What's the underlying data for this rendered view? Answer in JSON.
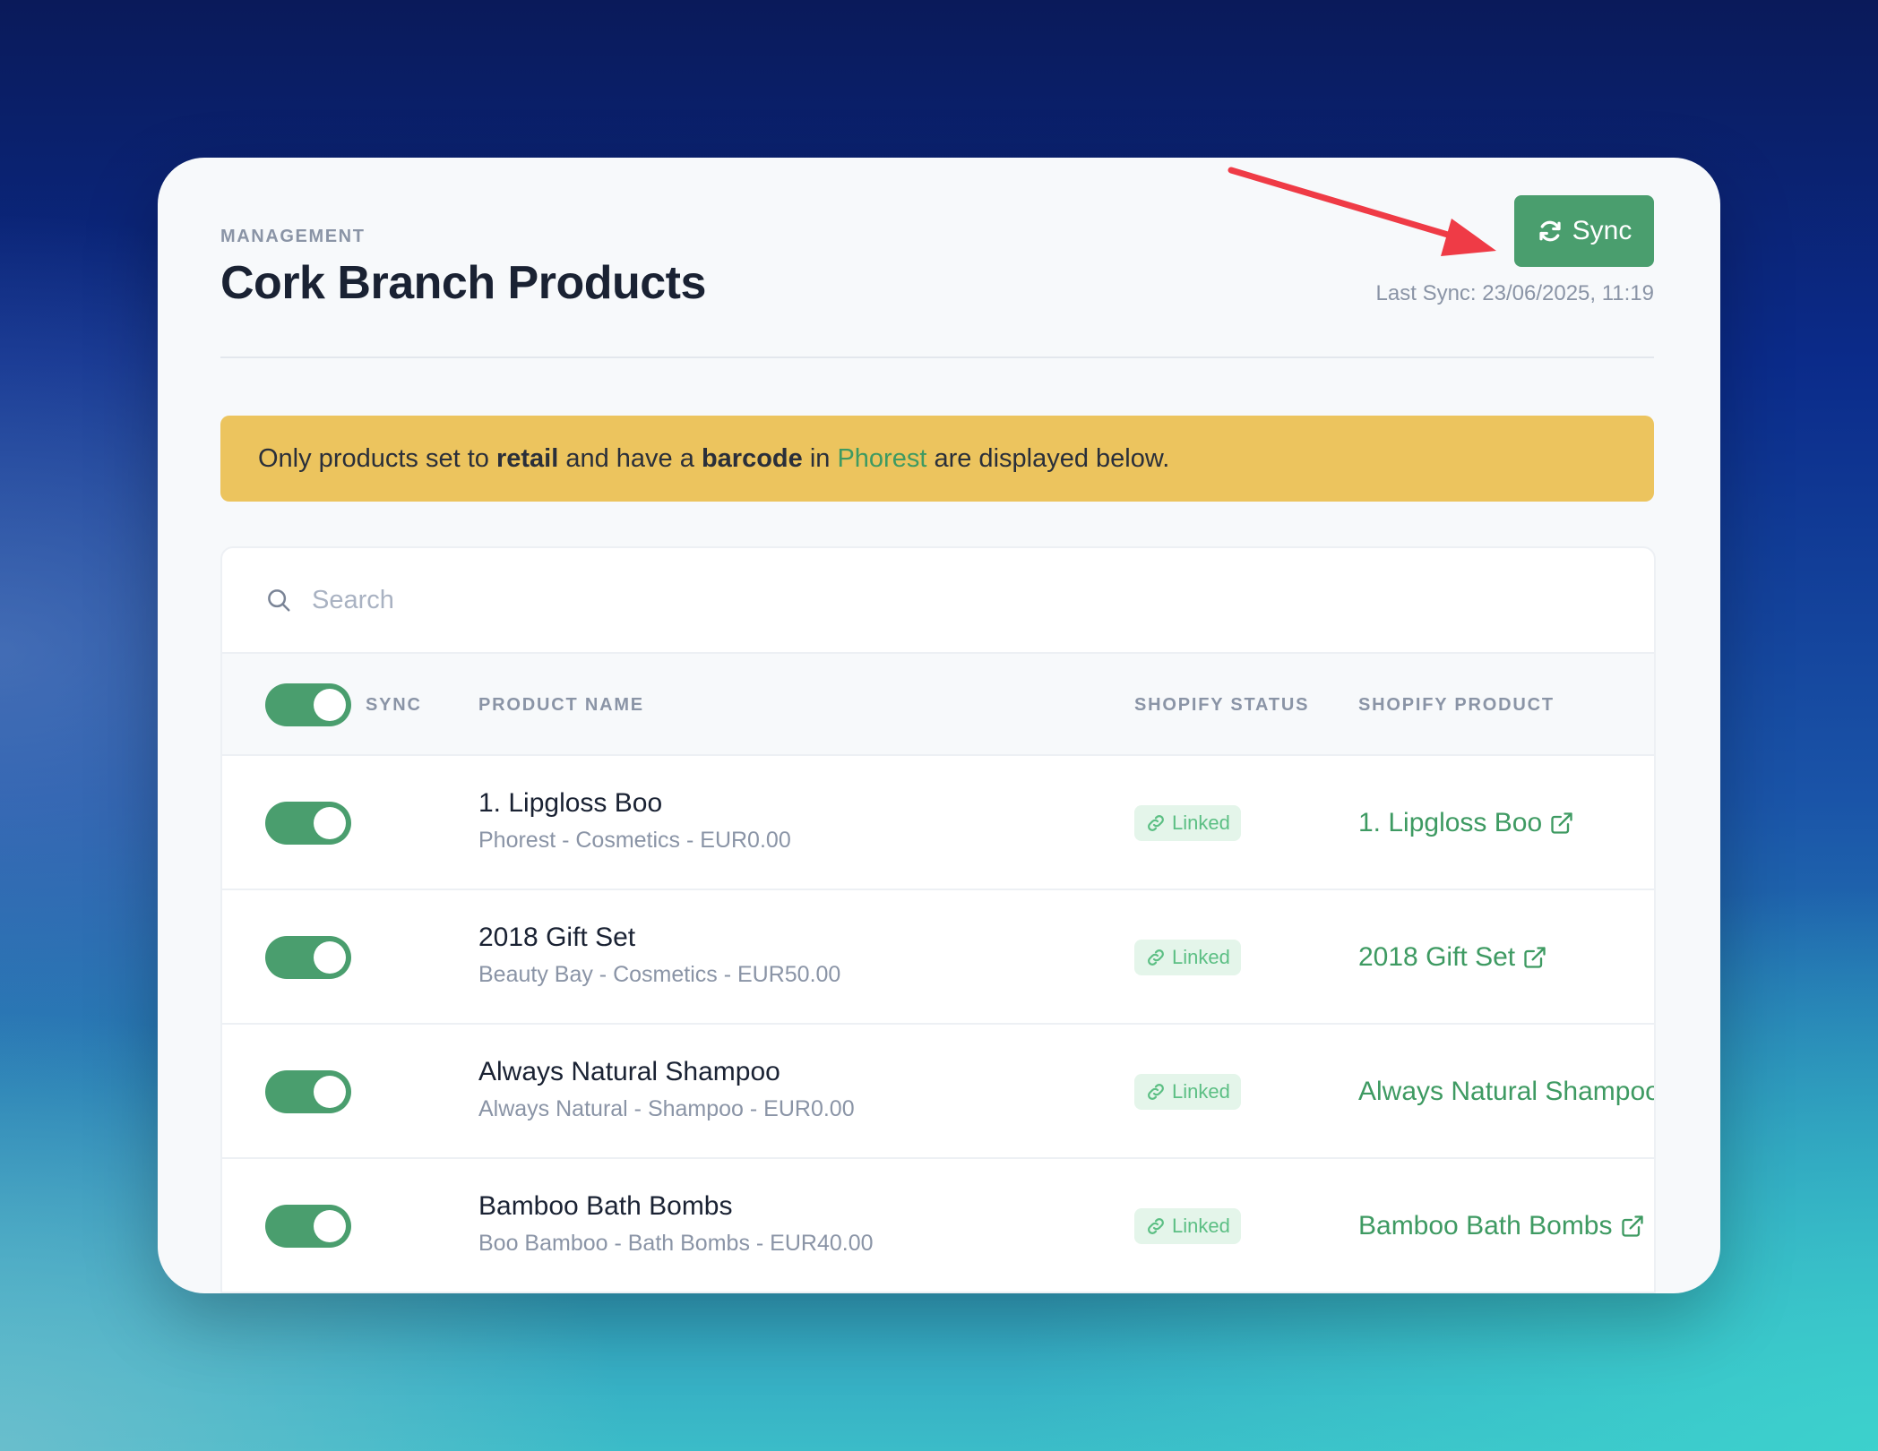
{
  "header": {
    "eyebrow": "MANAGEMENT",
    "title": "Cork Branch Products",
    "sync_button": "Sync",
    "last_sync": "Last Sync: 23/06/2025, 11:19"
  },
  "notice": {
    "part1": "Only products set to ",
    "bold1": "retail",
    "part2": " and have a ",
    "bold2": "barcode",
    "part3": " in ",
    "brand": "Phorest",
    "part4": " are displayed below."
  },
  "search": {
    "placeholder": "Search",
    "value": ""
  },
  "table": {
    "columns": {
      "sync": "SYNC",
      "product_name": "PRODUCT NAME",
      "shopify_status": "SHOPIFY STATUS",
      "shopify_product": "SHOPIFY PRODUCT"
    },
    "sync_all": true,
    "rows": [
      {
        "name": "1. Lipgloss Boo",
        "meta": "Phorest - Cosmetics - EUR0.00",
        "status": "Linked",
        "shopify_product": "1. Lipgloss Boo",
        "sync": true
      },
      {
        "name": "2018 Gift Set",
        "meta": "Beauty Bay - Cosmetics - EUR50.00",
        "status": "Linked",
        "shopify_product": "2018 Gift Set",
        "sync": true
      },
      {
        "name": "Always Natural Shampoo",
        "meta": "Always Natural - Shampoo - EUR0.00",
        "status": "Linked",
        "shopify_product": "Always Natural Shampoo",
        "sync": true
      },
      {
        "name": "Bamboo Bath Bombs",
        "meta": "Boo Bamboo - Bath Bombs - EUR40.00",
        "status": "Linked",
        "shopify_product": "Bamboo Bath Bombs",
        "sync": true
      }
    ]
  },
  "icons": {
    "sync": "refresh-icon",
    "search": "search-icon",
    "linked": "link-icon",
    "external": "external-link-icon"
  },
  "colors": {
    "accent": "#4a9e6e",
    "notice_bg": "#ecc45e",
    "badge_bg": "#e4f5ea",
    "badge_text": "#5cbf84",
    "annotation_arrow": "#ef3b46"
  }
}
